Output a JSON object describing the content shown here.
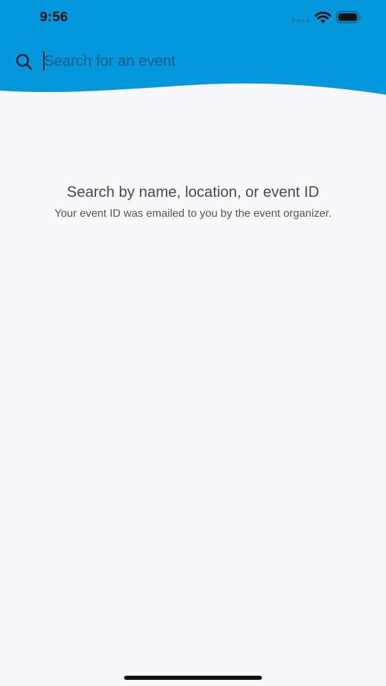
{
  "status_bar": {
    "time": "9:56"
  },
  "search": {
    "placeholder": "Search for an event",
    "value": ""
  },
  "empty_state": {
    "title": "Search by name, location, or event ID",
    "subtitle": "Your event ID was emailed to you by the event organizer."
  },
  "colors": {
    "header_blue": "#0497db",
    "background": "#f8f8fa"
  },
  "icons": {
    "search": "search-icon",
    "wifi": "wifi-icon",
    "battery": "battery-icon",
    "signal": "cellular-signal-icon"
  }
}
